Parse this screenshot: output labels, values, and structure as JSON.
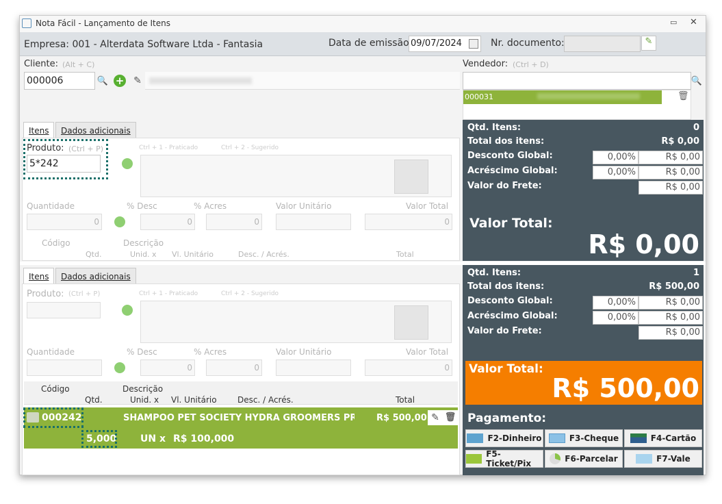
{
  "window": {
    "title": "Nota Fácil - Lançamento de Itens"
  },
  "header": {
    "empresa": "Empresa: 001 - Alterdata Software Ltda - Fantasia",
    "data_label": "Data de emissão:",
    "data_value": "09/07/2024",
    "doc_label": "Nr. documento:",
    "doc_value": ""
  },
  "cliente": {
    "label": "Cliente:",
    "shortcut": "(Alt + C)",
    "code": "000006"
  },
  "vendedor": {
    "label": "Vendedor:",
    "shortcut": "(Ctrl + D)",
    "selected_code": "000031"
  },
  "tabs": {
    "itens": "Itens",
    "dados": "Dados adicionais"
  },
  "produto": {
    "label": "Produto:",
    "shortcut": "(Ctrl + P)",
    "value": "5*242",
    "hint1": "Ctrl + 1 - Praticado",
    "hint2": "Ctrl + 2 - Sugerido"
  },
  "fields": {
    "quantidade": "Quantidade",
    "desc": "% Desc",
    "acres": "% Acres",
    "vunit": "Valor Unitário",
    "vtotal": "Valor Total",
    "zero": "0"
  },
  "grid_headers": {
    "codigo": "Código",
    "qtd": "Qtd.",
    "descricao": "Descrição",
    "unid": "Unid. x",
    "vlunit": "Vl. Unitário",
    "descacres": "Desc. / Acrés.",
    "total": "Total"
  },
  "summary_top": {
    "qtd_label": "Qtd. Itens:",
    "qtd": "0",
    "total_label": "Total dos itens:",
    "total": "R$ 0,00",
    "desc_label": "Desconto Global:",
    "desc_pct": "0,00%",
    "desc_val": "R$ 0,00",
    "acres_label": "Acréscimo Global:",
    "acres_pct": "0,00%",
    "acres_val": "R$ 0,00",
    "frete_label": "Valor do Frete:",
    "frete": "R$ 0,00",
    "vt_label": "Valor Total:",
    "vt": "R$ 0,00"
  },
  "summary_bottom": {
    "qtd_label": "Qtd. Itens:",
    "qtd": "1",
    "total_label": "Total dos itens:",
    "total": "R$ 500,00",
    "desc_label": "Desconto Global:",
    "desc_pct": "0,00%",
    "desc_val": "R$ 0,00",
    "acres_label": "Acréscimo Global:",
    "acres_pct": "0,00%",
    "acres_val": "R$ 0,00",
    "frete_label": "Valor do Frete:",
    "frete": "R$ 0,00",
    "vt_label": "Valor Total:",
    "vt": "R$ 500,00"
  },
  "item": {
    "code": "000242",
    "desc": "SHAMPOO PET SOCIETY HYDRA GROOMERS PR(",
    "total": "R$ 500,00",
    "qtd": "5,000",
    "unid": "UN x",
    "vunit": "R$ 100,000"
  },
  "payment": {
    "title": "Pagamento:",
    "buttons": [
      "F2-Dinheiro",
      "F3-Cheque",
      "F4-Cartão",
      "F5-Ticket/Pix",
      "F6-Parcelar",
      "F7-Vale"
    ]
  },
  "colors": {
    "dark": "#485760",
    "green": "#8eb33b",
    "orange": "#f57e00",
    "teal": "#1a6f69"
  }
}
